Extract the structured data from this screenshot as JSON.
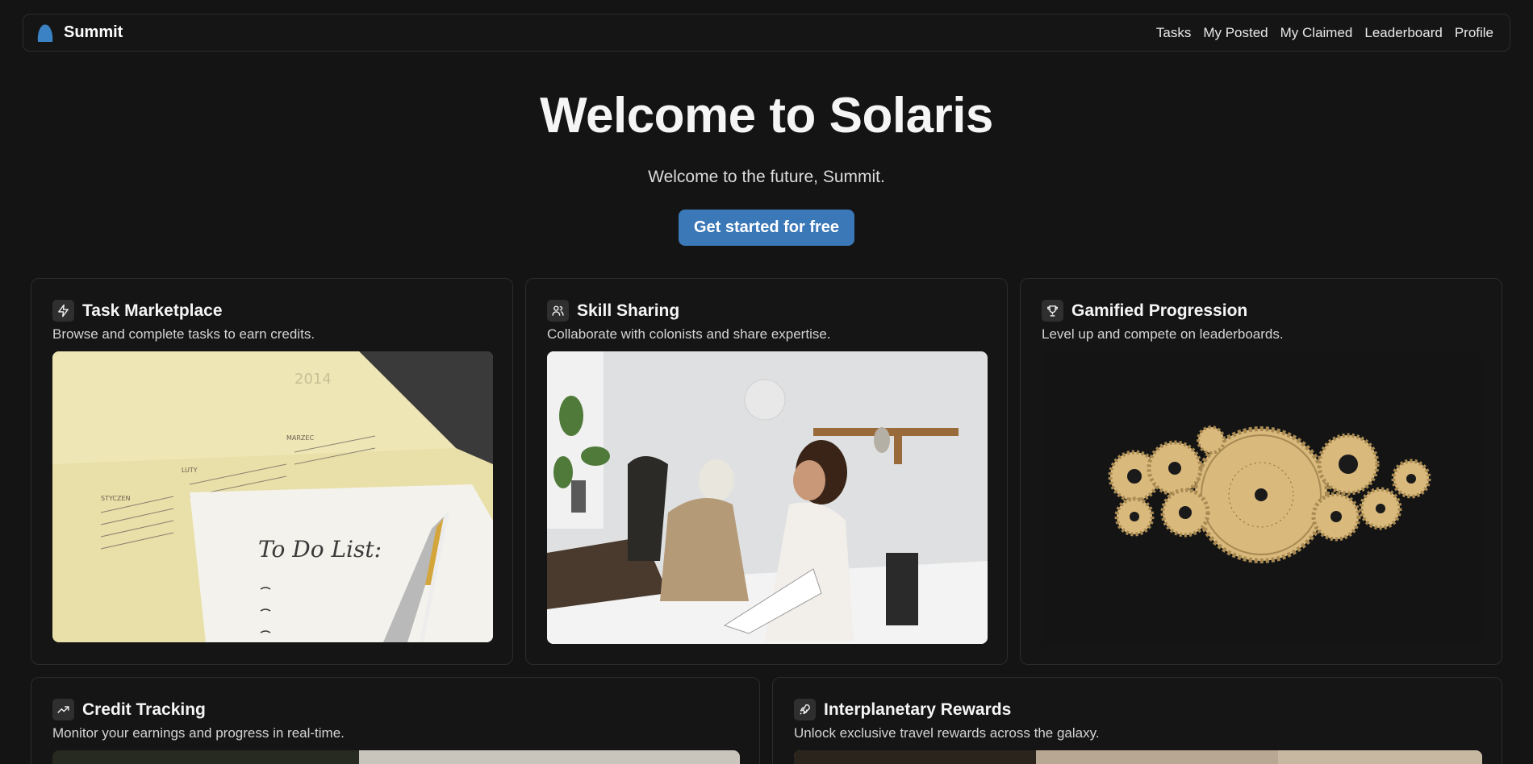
{
  "header": {
    "brand_name": "Summit",
    "nav": [
      "Tasks",
      "My Posted",
      "My Claimed",
      "Leaderboard",
      "Profile"
    ]
  },
  "hero": {
    "title": "Welcome to Solaris",
    "subtitle": "Welcome to the future, Summit.",
    "cta_label": "Get started for free"
  },
  "features": [
    {
      "icon": "zap-icon",
      "title": "Task Marketplace",
      "description": "Browse and complete tasks to earn credits.",
      "image_text": "To Do List:"
    },
    {
      "icon": "users-icon",
      "title": "Skill Sharing",
      "description": "Collaborate with colonists and share expertise."
    },
    {
      "icon": "trophy-icon",
      "title": "Gamified Progression",
      "description": "Level up and compete on leaderboards."
    },
    {
      "icon": "trending-up-icon",
      "title": "Credit Tracking",
      "description": "Monitor your earnings and progress in real-time."
    },
    {
      "icon": "rocket-icon",
      "title": "Interplanetary Rewards",
      "description": "Unlock exclusive travel rewards across the galaxy."
    }
  ],
  "colors": {
    "background": "#141414",
    "card_border": "#2c2c2c",
    "accent": "#3a78b8",
    "logo": "#3b82c4"
  }
}
